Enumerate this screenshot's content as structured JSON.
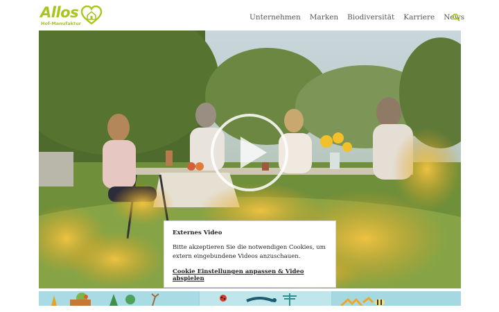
{
  "brand": {
    "name": "Allos",
    "tagline": "Hof-Manufaktur",
    "color": "#a9c41b"
  },
  "nav": {
    "items": [
      {
        "label": "Unternehmen"
      },
      {
        "label": "Marken"
      },
      {
        "label": "Biodiversität"
      },
      {
        "label": "Karriere"
      },
      {
        "label": "News"
      }
    ],
    "search_icon": "search-icon"
  },
  "video": {
    "play_icon": "play-icon"
  },
  "consent": {
    "title": "Externes Video",
    "text": "Bitte akzeptieren Sie die notwendigen Cookies, um extern eingebundene Videos anzuschauen.",
    "link_label": "Cookie Einstellungen anpassen & Video abspielen"
  }
}
